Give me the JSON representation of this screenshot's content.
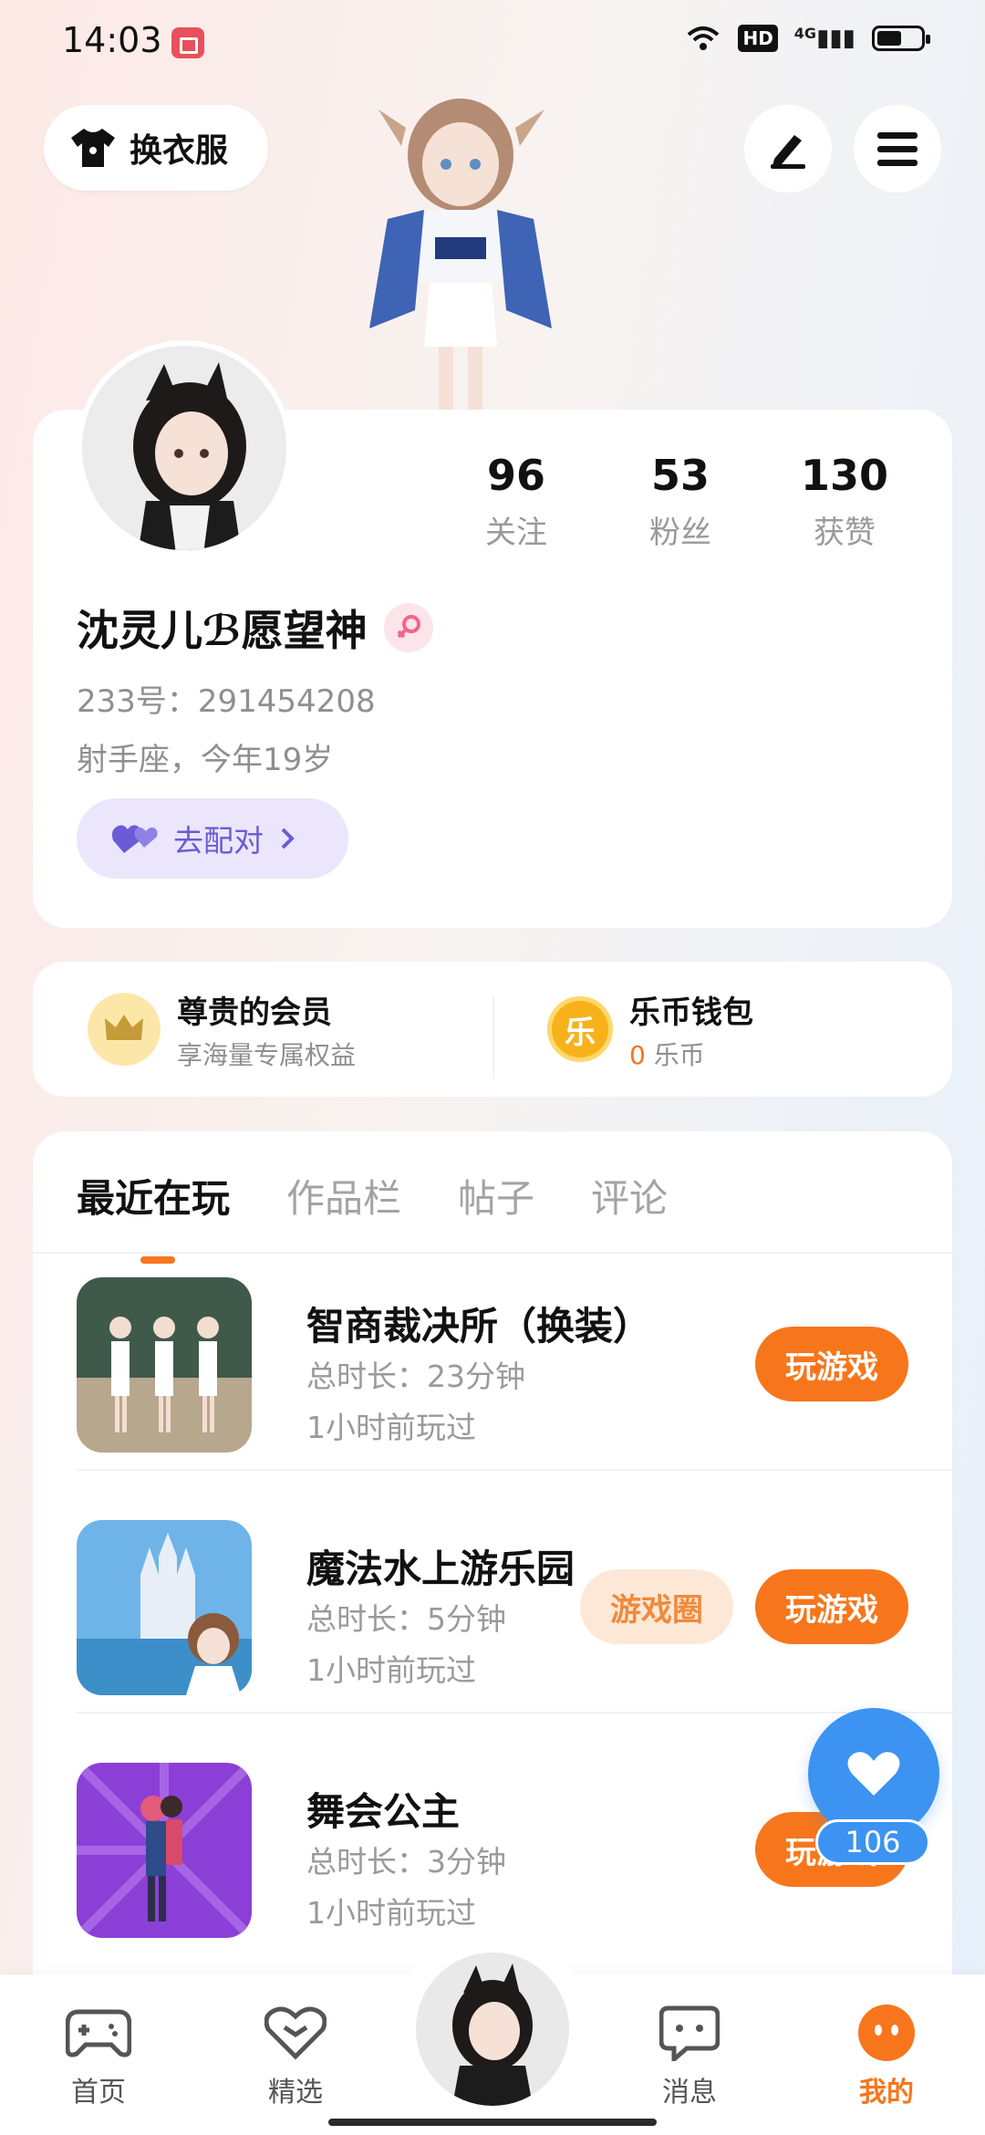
{
  "status_bar": {
    "time": "14:03",
    "hd": "HD",
    "signal": "4G"
  },
  "top_bar": {
    "outfit_label": "换衣服"
  },
  "profile": {
    "stats": [
      {
        "value": "96",
        "label": "关注"
      },
      {
        "value": "53",
        "label": "粉丝"
      },
      {
        "value": "130",
        "label": "获赞"
      }
    ],
    "nickname": "沈灵儿ℬ愿望神",
    "uid": "233号：291454208",
    "bio": "射手座，今年19岁",
    "match_label": "去配对"
  },
  "membership": {
    "vip_title": "尊贵的会员",
    "vip_sub": "享海量专属权益",
    "wallet_title": "乐币钱包",
    "wallet_amount": "0",
    "wallet_unit": "乐币",
    "coin_glyph": "乐"
  },
  "tabs": [
    "最近在玩",
    "作品栏",
    "帖子",
    "评论"
  ],
  "games": [
    {
      "name": "智商裁决所（换装）",
      "duration": "总时长：23分钟",
      "last_played": "1小时前玩过",
      "play_label": "玩游戏"
    },
    {
      "name": "魔法水上游乐园",
      "duration": "总时长：5分钟",
      "last_played": "1小时前玩过",
      "circle_label": "游戏圈",
      "play_label": "玩游戏"
    },
    {
      "name": "舞会公主",
      "duration": "总时长：3分钟",
      "last_played": "1小时前玩过",
      "play_label": "玩游戏"
    }
  ],
  "float_like": {
    "count": "106"
  },
  "bottom_nav": [
    {
      "label": "首页"
    },
    {
      "label": "精选"
    },
    {
      "label": "消息"
    },
    {
      "label": "我的"
    }
  ],
  "colors": {
    "accent": "#f7761c",
    "match_purple": "#6b5bd6",
    "like_blue": "#3c93f1"
  }
}
